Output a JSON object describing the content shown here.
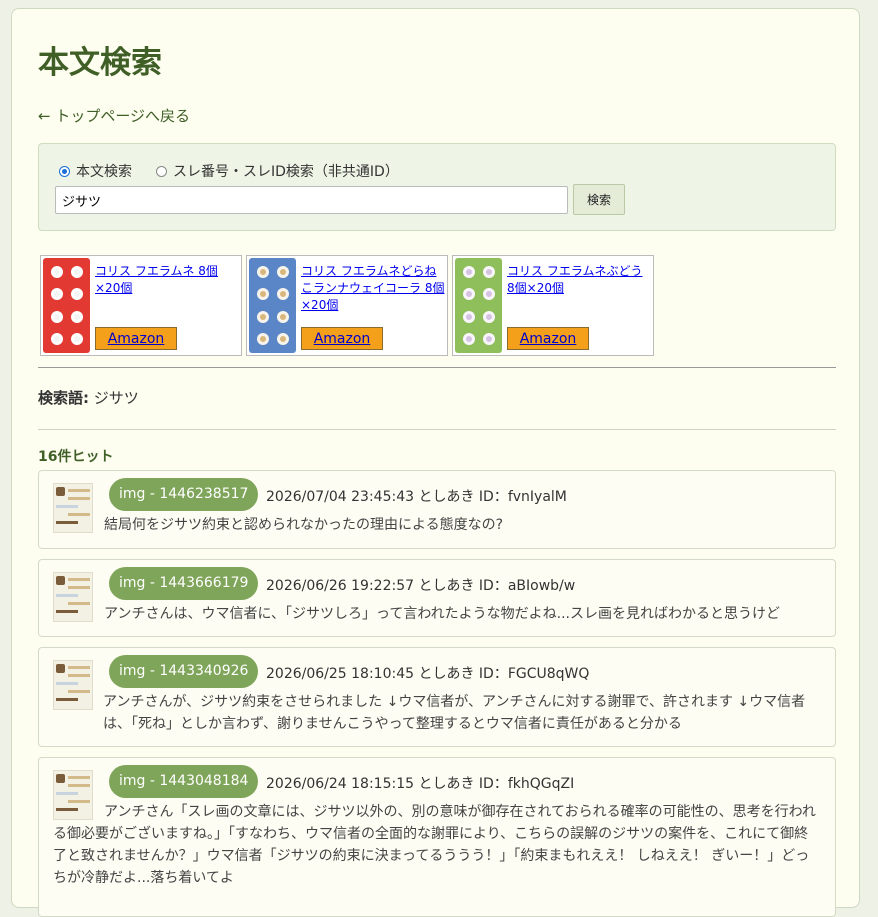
{
  "page": {
    "title": "本文検索",
    "back_link": "← トップページへ戻る"
  },
  "search": {
    "mode_body": "本文検索",
    "mode_id": "スレ番号・スレID検索（非共通ID）",
    "query": "ジサツ",
    "button": "検索"
  },
  "ads": [
    {
      "name": "コリス フエラムネ 8個×20個",
      "button": "Amazon",
      "colors": [
        "#e23a33",
        "#f4f4f4"
      ]
    },
    {
      "name": "コリス フエラムネどらねこランナウェイコーラ 8個×20個",
      "button": "Amazon",
      "colors": [
        "#5a86c8",
        "#d8b67c"
      ]
    },
    {
      "name": "コリス フエラムネぶどう 8個×20個",
      "button": "Amazon",
      "colors": [
        "#8fbf5a",
        "#d6c2e2"
      ]
    }
  ],
  "summary": {
    "term_label": "検索語:",
    "term_value": "ジサツ",
    "hits": "16件ヒット"
  },
  "results": [
    {
      "img": "img - 1446238517",
      "meta": "2026/07/04 23:45:43 としあき ID：fvnIyalM",
      "text": "結局何をジサツ約束と認められなかったの理由による態度なの?"
    },
    {
      "img": "img - 1443666179",
      "meta": "2026/06/26 19:22:57 としあき ID：aBIowb/w",
      "text": "アンチさんは、ウマ信者に、「ジサツしろ」って言われたような物だよね...スレ画を見ればわかると思うけど"
    },
    {
      "img": "img - 1443340926",
      "meta": "2026/06/25 18:10:45 としあき ID：FGCU8qWQ",
      "text": "アンチさんが、ジサツ約束をさせられました ↓ウマ信者が、アンチさんに対する謝罪で、許されます ↓ウマ信者は、「死ね」としか言わず、謝りませんこうやって整理するとウマ信者に責任があると分かる"
    },
    {
      "img": "img - 1443048184",
      "meta": "2026/06/24 18:15:15 としあき ID：fkhQGqZI",
      "text": "アンチさん「スレ画の文章には、ジサツ以外の、別の意味が御存在されておられる確率の可能性の、思考を行われる御必要がございますね。」「すなわち、ウマ信者の全面的な謝罪により、こちらの誤解のジサツの案件を、これにて御終了と致されませんか？」ウマ信者「ジサツの約束に決まってるううう！」「約束まもれええ！ しねええ！ ぎいー！」どっちが冷静だよ...落ち着いてよ"
    }
  ]
}
